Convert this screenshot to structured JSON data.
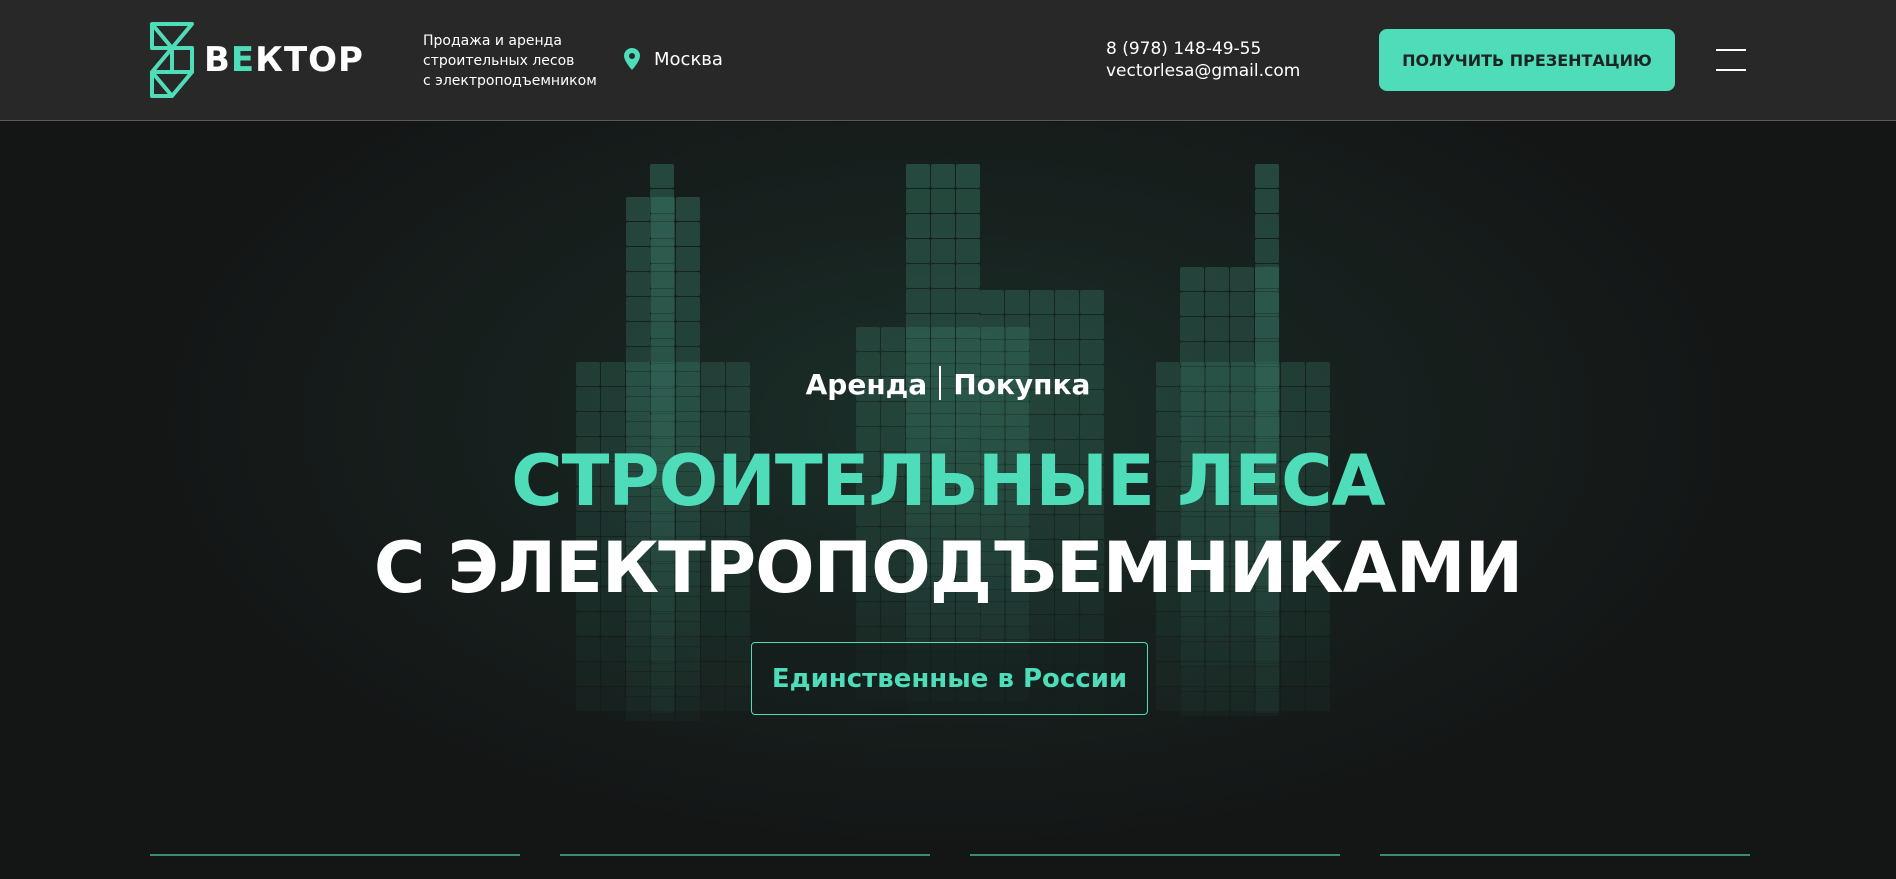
{
  "header": {
    "logo": {
      "text_prefix": "В",
      "text_accent": "Е",
      "text_suffix": "КТОР",
      "icon": "triangle-lattice-logo"
    },
    "tagline": [
      "Продажа и аренда",
      "строительных лесов",
      "с электроподъемником"
    ],
    "city": {
      "icon": "map-pin-icon",
      "label": "Москва"
    },
    "phone": "8 (978) 148-49-55",
    "email": "vectorlesa@gmail.com",
    "cta_label": "ПОЛУЧИТЬ ПРЕЗЕНТАЦИЮ",
    "menu_icon": "hamburger-menu-icon"
  },
  "hero": {
    "mode_rent": "Аренда",
    "mode_buy": "Покупка",
    "title_line1": "СТРОИТЕЛЬНЫЕ ЛЕСА",
    "title_line2": "С ЭЛЕКТРОПОДЪЕМНИКАМИ",
    "badge": "Единственные в России"
  },
  "colors": {
    "accent": "#4fdcb8",
    "header_bg": "#282828",
    "page_bg": "#141616"
  }
}
